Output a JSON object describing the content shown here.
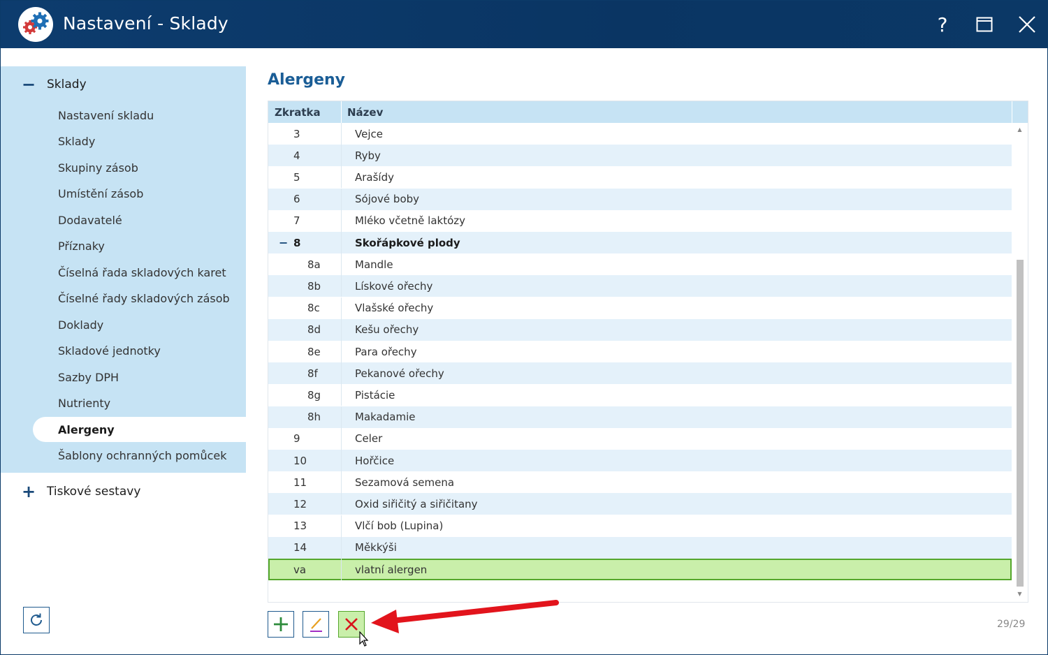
{
  "window": {
    "title": "Nastavení - Sklady",
    "help_glyph": "?"
  },
  "sidebar": {
    "groups": [
      {
        "label": "Sklady",
        "sign": "−",
        "items": [
          {
            "label": "Nastavení skladu"
          },
          {
            "label": "Sklady"
          },
          {
            "label": "Skupiny zásob"
          },
          {
            "label": "Umístění zásob"
          },
          {
            "label": "Dodavatelé"
          },
          {
            "label": "Příznaky"
          },
          {
            "label": "Číselná řada skladových karet"
          },
          {
            "label": "Číselné řady skladových zásob"
          },
          {
            "label": "Doklady"
          },
          {
            "label": "Skladové jednotky"
          },
          {
            "label": "Sazby DPH"
          },
          {
            "label": "Nutrienty"
          },
          {
            "label": "Alergeny",
            "active": true
          },
          {
            "label": "Šablony ochranných pomůcek"
          }
        ]
      },
      {
        "label": "Tiskové sestavy",
        "sign": "+"
      }
    ]
  },
  "main": {
    "title": "Alergeny",
    "columns": {
      "code": "Zkratka",
      "name": "Název"
    },
    "rows": [
      {
        "code": "3",
        "name": "Vejce",
        "level": 0
      },
      {
        "code": "4",
        "name": "Ryby",
        "level": 0
      },
      {
        "code": "5",
        "name": "Arašídy",
        "level": 0
      },
      {
        "code": "6",
        "name": "Sójové boby",
        "level": 0
      },
      {
        "code": "7",
        "name": "Mléko včetně laktózy",
        "level": 0
      },
      {
        "code": "8",
        "name": "Skořápkové plody",
        "level": 0,
        "group": true,
        "toggle": "−"
      },
      {
        "code": "8a",
        "name": "Mandle",
        "level": 1
      },
      {
        "code": "8b",
        "name": "Lískové ořechy",
        "level": 1
      },
      {
        "code": "8c",
        "name": "Vlašské ořechy",
        "level": 1
      },
      {
        "code": "8d",
        "name": "Kešu ořechy",
        "level": 1
      },
      {
        "code": "8e",
        "name": "Para ořechy",
        "level": 1
      },
      {
        "code": "8f",
        "name": "Pekanové ořechy",
        "level": 1
      },
      {
        "code": "8g",
        "name": "Pistácie",
        "level": 1
      },
      {
        "code": "8h",
        "name": "Makadamie",
        "level": 1
      },
      {
        "code": "9",
        "name": "Celer",
        "level": 0
      },
      {
        "code": "10",
        "name": "Hořčice",
        "level": 0
      },
      {
        "code": "11",
        "name": "Sezamová semena",
        "level": 0
      },
      {
        "code": "12",
        "name": "Oxid siřičitý a siřičitany",
        "level": 0
      },
      {
        "code": "13",
        "name": "Vlčí bob (Lupina)",
        "level": 0
      },
      {
        "code": "14",
        "name": "Měkkýši",
        "level": 0
      },
      {
        "code": "va",
        "name": "vlatní alergen",
        "level": 0,
        "selected": true
      }
    ],
    "counter": "29/29"
  },
  "toolbar": {
    "add_icon": "plus-icon",
    "edit_icon": "pencil-icon",
    "delete_icon": "close-icon"
  },
  "colors": {
    "titlebar": "#0b3866",
    "sidebar_group": "#c6e3f4",
    "accent_title": "#1a5d96",
    "selected_row": "#c9efaa",
    "selected_border": "#55a72c",
    "annotation_arrow": "#e2141c"
  }
}
